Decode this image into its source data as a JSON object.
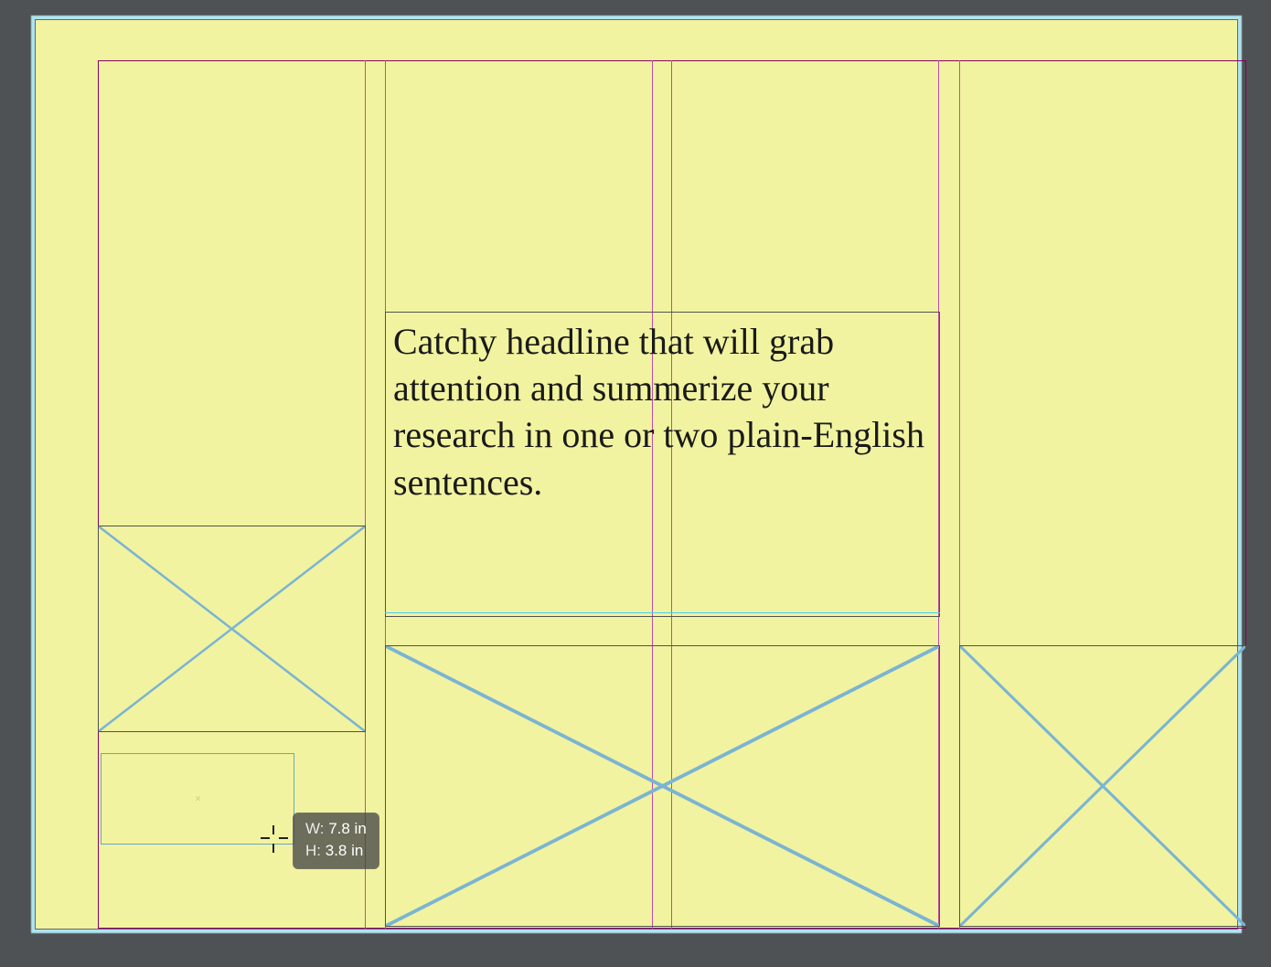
{
  "canvas": {
    "background": "#4f5254",
    "page_color": "#f1f3a0"
  },
  "headline": {
    "text": "Catchy headline that will grab attention and summerize your research in one or two plain-English sentences."
  },
  "measurement": {
    "width_label": "W:",
    "width_value": "7.8 in",
    "height_label": "H:",
    "height_value": "3.8 in"
  }
}
